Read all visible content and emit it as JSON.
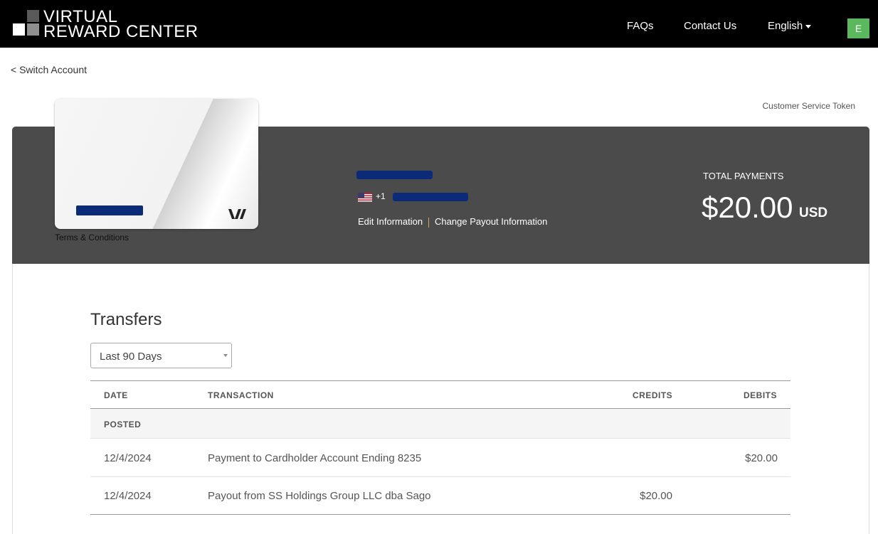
{
  "header": {
    "logo_line1": "VIRTUAL",
    "logo_line2": "REWARD CENTER",
    "nav": {
      "faqs": "FAQs",
      "contact": "Contact Us",
      "language": "English"
    },
    "avatar_initial": "E"
  },
  "switch_account": "< Switch Account",
  "customer_service_token": "Customer Service Token",
  "card": {
    "terms": "Terms & Conditions"
  },
  "profile": {
    "phone_prefix": "+1",
    "edit_info": "Edit Information",
    "change_payout": "Change Payout Information"
  },
  "totals": {
    "label": "TOTAL PAYMENTS",
    "amount": "$20.00",
    "currency": "USD"
  },
  "transfers": {
    "title": "Transfers",
    "filter": "Last 90 Days",
    "columns": {
      "date": "DATE",
      "transaction": "TRANSACTION",
      "credits": "CREDITS",
      "debits": "DEBITS"
    },
    "group": "POSTED",
    "rows": [
      {
        "date": "12/4/2024",
        "transaction": "Payment to Cardholder Account Ending 8235",
        "credits": "",
        "debits": "$20.00"
      },
      {
        "date": "12/4/2024",
        "transaction": "Payout from SS Holdings Group LLC dba Sago",
        "credits": "$20.00",
        "debits": ""
      }
    ]
  },
  "colors": {
    "topbar": "#000000",
    "banner": "#4b4b4b",
    "avatar": "#5cb85c",
    "redaction": "#0b2a78"
  }
}
